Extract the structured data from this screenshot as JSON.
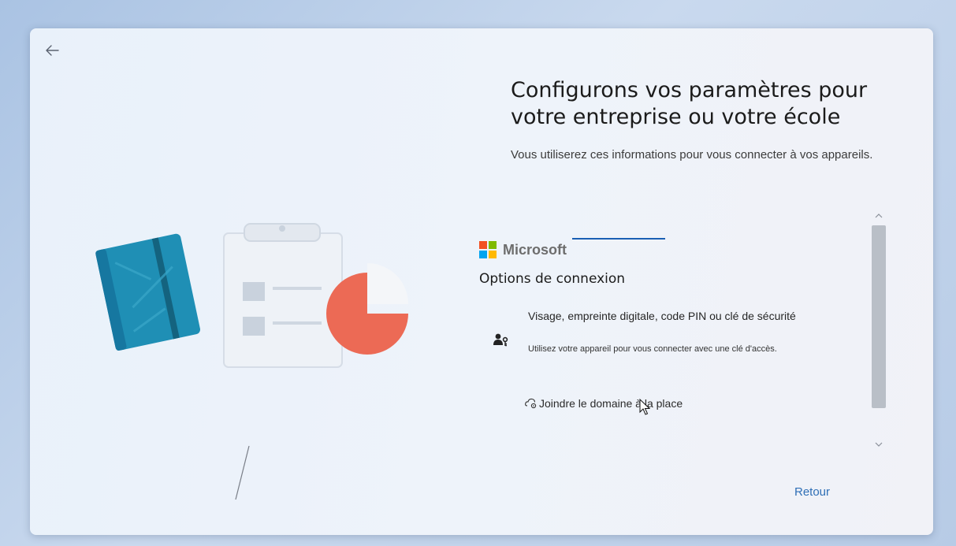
{
  "page": {
    "title": "Configurons vos paramètres pour votre entreprise ou votre école",
    "subtitle": "Vous utiliserez ces informations pour vous connecter à vos appareils."
  },
  "signin": {
    "brand": "Microsoft",
    "brand_colors": [
      "#f25022",
      "#7fba00",
      "#00a4ef",
      "#ffb900"
    ],
    "options_title": "Options de connexion",
    "option": {
      "icon": "user-key-icon",
      "title": "Visage, empreinte digitale, code PIN ou clé de sécurité",
      "description": "Utilisez votre appareil pour vous connecter avec une clé d'accès."
    },
    "domain_link": {
      "icon": "domain-icon",
      "label": "Joindre le domaine à la place"
    },
    "accent_color": "#1a5fb4"
  },
  "footer": {
    "back_label": "Retour"
  },
  "icons": {
    "back": "back-arrow-icon",
    "scroll_up": "chevron-up-icon",
    "scroll_down": "chevron-down-icon"
  }
}
